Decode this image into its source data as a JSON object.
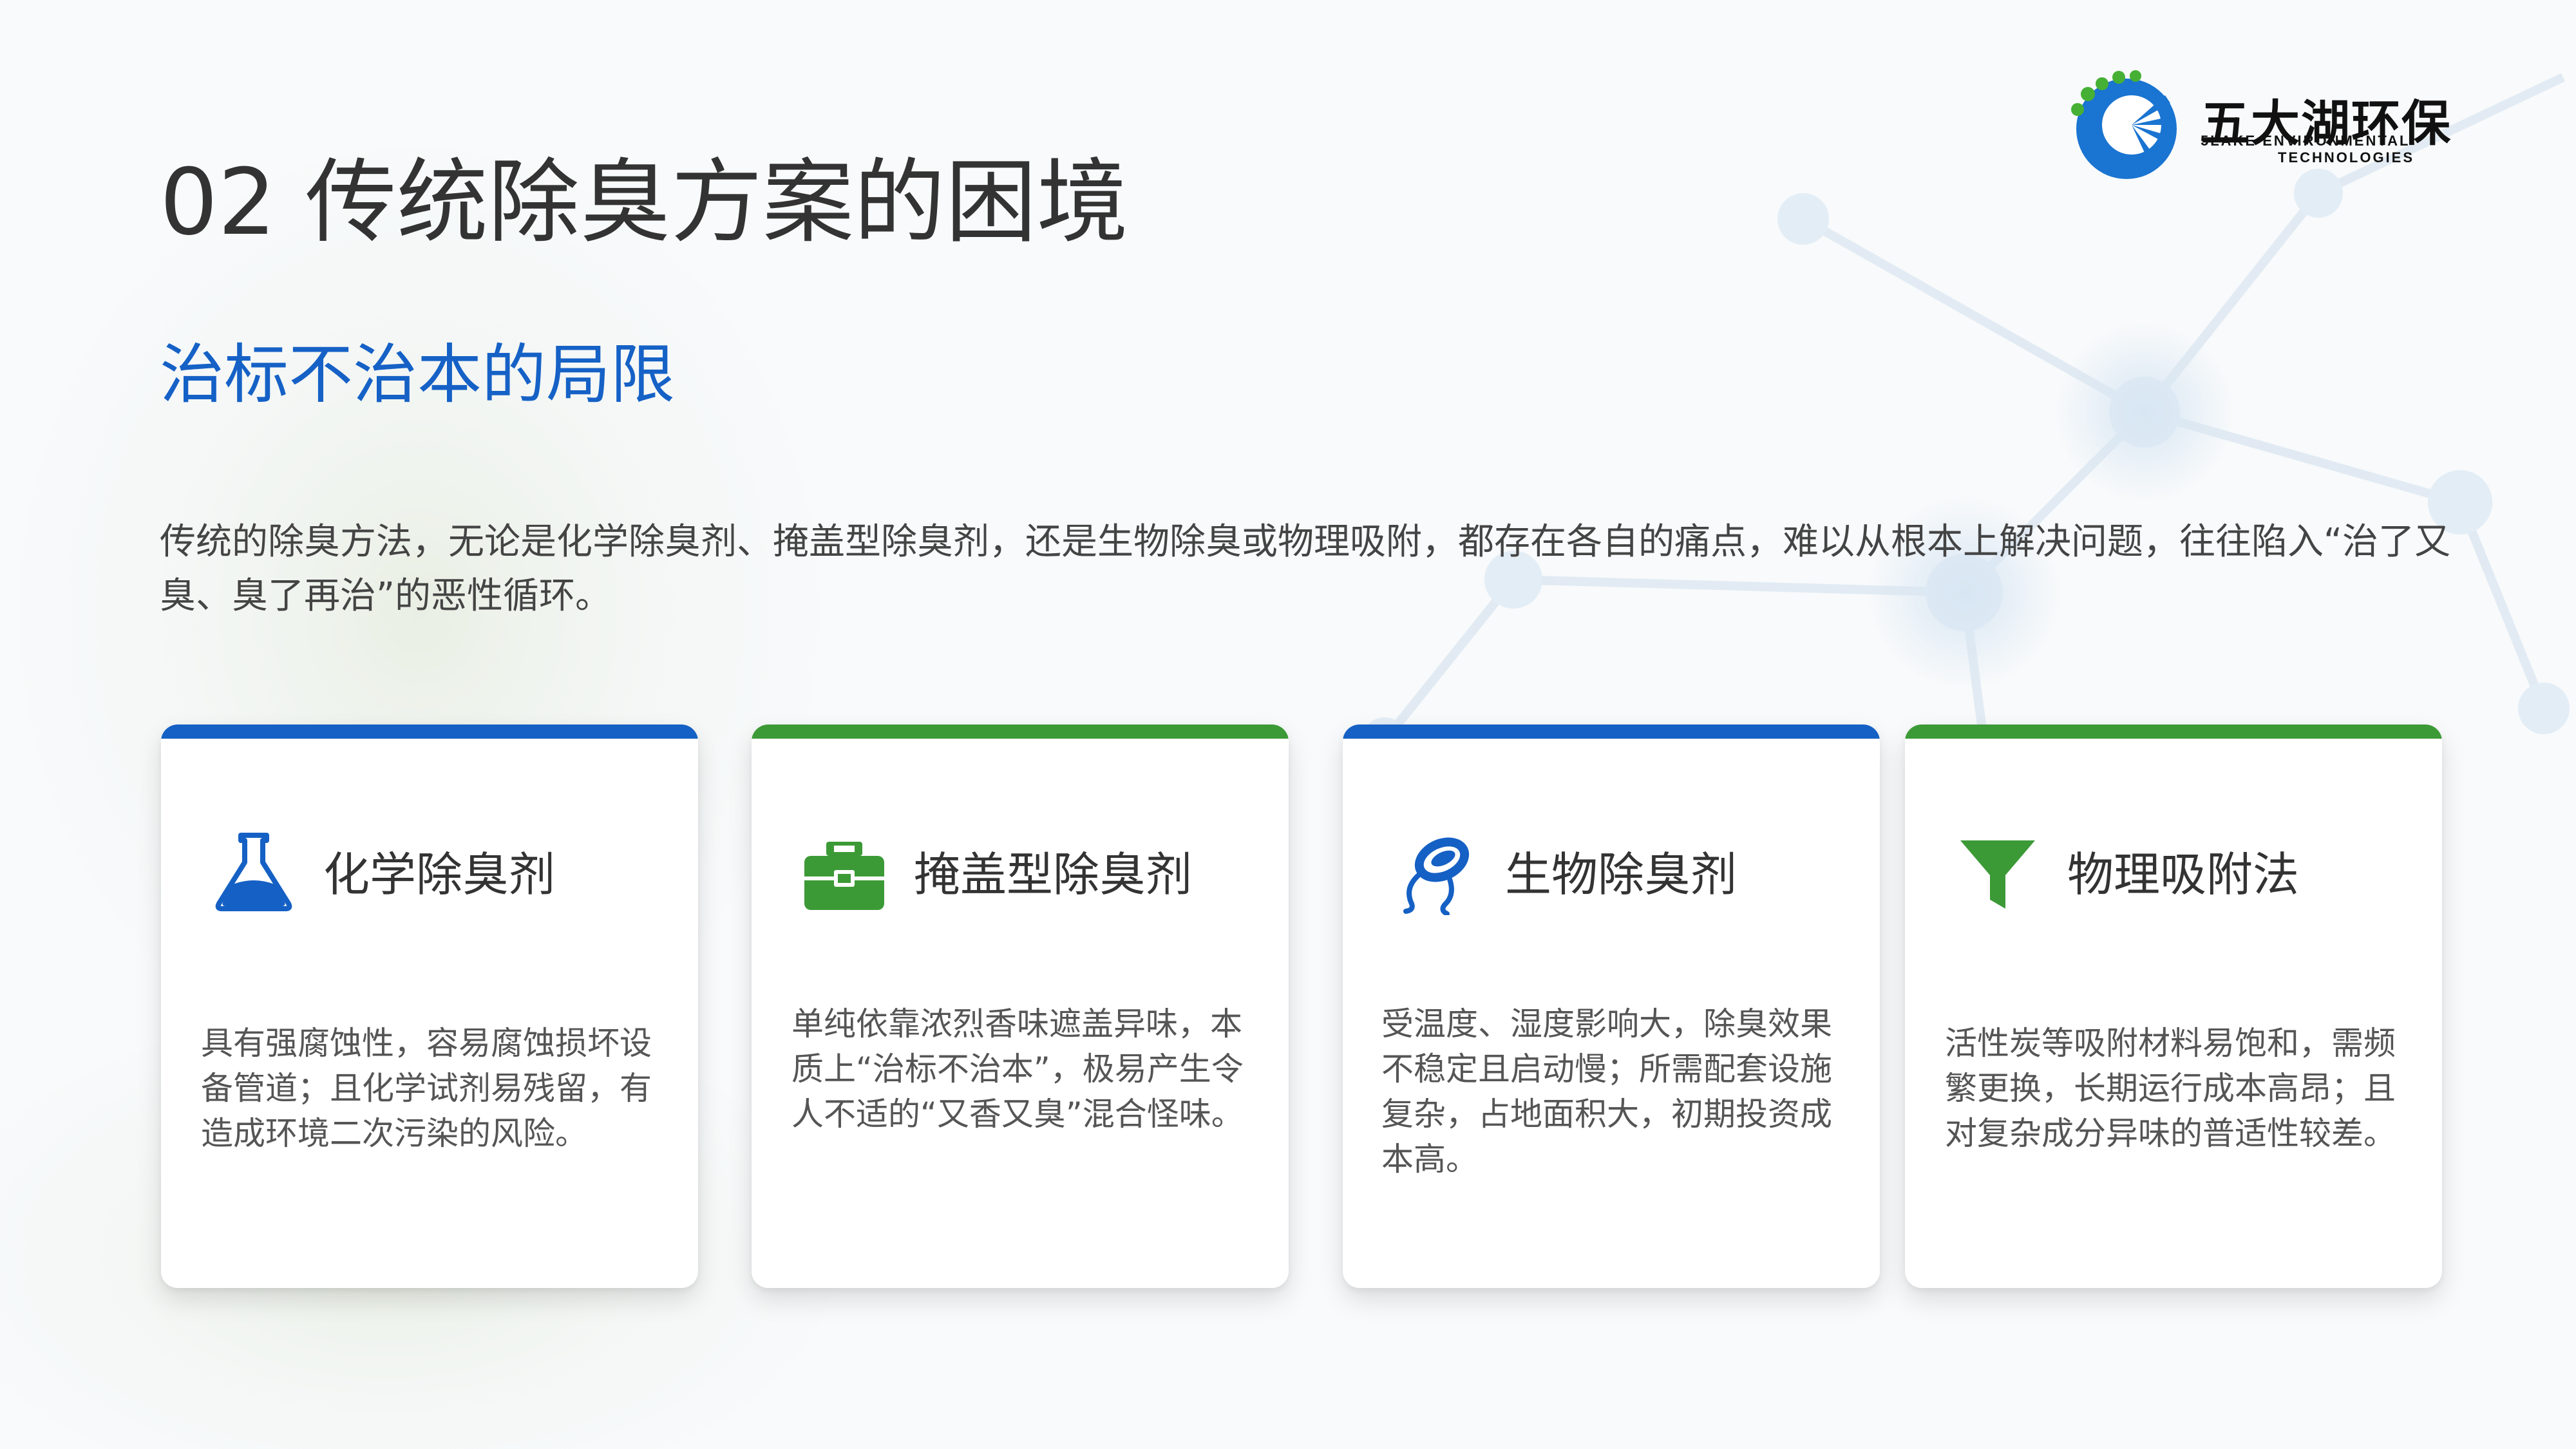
{
  "logo": {
    "name_cn": "五大湖环保",
    "name_en_line1": "5LAKE ENVIRONMENTAL",
    "name_en_line2": "TECHNOLOGIES",
    "colors": {
      "blue": "#1a74d1",
      "green": "#46b035"
    }
  },
  "header": {
    "title": "02 传统除臭方案的困境",
    "subtitle": "治标不治本的局限"
  },
  "intro": {
    "text": "传统的除臭方法，无论是化学除臭剂、掩盖型除臭剂，还是生物除臭或物理吸附，都存在各自的痛点，难以从根本上解决问题，往往陷入“治了又臭、臭了再治”的恶性循环。"
  },
  "cards": [
    {
      "title": "化学除臭剂",
      "icon": "flask-icon",
      "accent": "#1560c4",
      "description": "具有强腐蚀性，容易腐蚀损坏设备管道；且化学试剂易残留，有造成环境二次污染的风险。"
    },
    {
      "title": "掩盖型除臭剂",
      "icon": "medical-kit-icon",
      "accent": "#3c9a36",
      "description": "单纯依靠浓烈香味遮盖异味，本质上“治标不治本”，极易产生令人不适的“又香又臭”混合怪味。"
    },
    {
      "title": "生物除臭剂",
      "icon": "bacteria-icon",
      "accent": "#1560c4",
      "description": "受温度、湿度影响大，除臭效果不稳定且启动慢；所需配套设施复杂，占地面积大，初期投资成本高。"
    },
    {
      "title": "物理吸附法",
      "icon": "funnel-icon",
      "accent": "#3c9a36",
      "description": "活性炭等吸附材料易饱和，需频繁更换，长期运行成本高昂；且对复杂成分异味的普适性较差。"
    }
  ],
  "colors": {
    "title_text": "#333333",
    "subtitle_blue": "#1561c6",
    "bar_blue": "#1560c4",
    "bar_green": "#3c9a36"
  }
}
